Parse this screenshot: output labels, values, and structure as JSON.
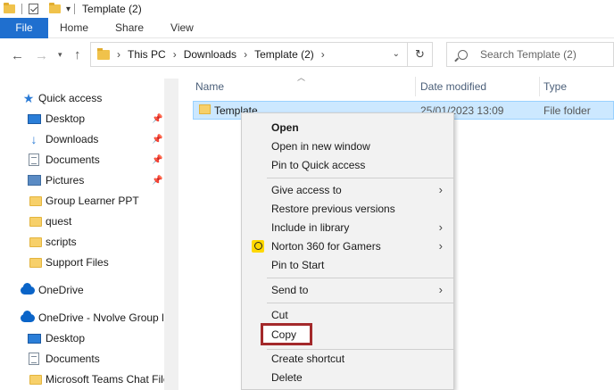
{
  "window": {
    "title": "Template (2)"
  },
  "ribbon": {
    "tabs": [
      "File",
      "Home",
      "Share",
      "View"
    ]
  },
  "address": {
    "crumbs": [
      "This PC",
      "Downloads",
      "Template (2)"
    ],
    "search_placeholder": "Search Template (2)"
  },
  "nav": {
    "items": [
      {
        "label": "Quick access",
        "icon": "star-icon"
      },
      {
        "label": "Desktop",
        "icon": "desktop-icon",
        "pinned": true
      },
      {
        "label": "Downloads",
        "icon": "download-icon",
        "pinned": true
      },
      {
        "label": "Documents",
        "icon": "document-icon",
        "pinned": true
      },
      {
        "label": "Pictures",
        "icon": "pictures-icon",
        "pinned": true
      },
      {
        "label": "Group Learner PPT",
        "icon": "folder-icon"
      },
      {
        "label": "quest",
        "icon": "folder-icon"
      },
      {
        "label": "scripts",
        "icon": "folder-icon"
      },
      {
        "label": "Support Files",
        "icon": "folder-icon"
      },
      {
        "label": "OneDrive",
        "icon": "cloud-icon"
      },
      {
        "label": "OneDrive - Nvolve Group Li",
        "icon": "cloud-icon"
      },
      {
        "label": "Desktop",
        "icon": "desktop-icon"
      },
      {
        "label": "Documents",
        "icon": "document-icon"
      },
      {
        "label": "Microsoft Teams Chat File",
        "icon": "folder-icon"
      }
    ]
  },
  "filelist": {
    "columns": [
      "Name",
      "Date modified",
      "Type"
    ],
    "rows": [
      {
        "name": "Template",
        "date": "25/01/2023 13:09",
        "type": "File folder"
      }
    ]
  },
  "context_menu": {
    "items": [
      {
        "label": "Open",
        "bold": true
      },
      {
        "label": "Open in new window"
      },
      {
        "label": "Pin to Quick access"
      },
      {
        "label": "Give access to",
        "submenu": true
      },
      {
        "label": "Restore previous versions"
      },
      {
        "label": "Include in library",
        "submenu": true
      },
      {
        "label": "Norton 360 for Gamers",
        "submenu": true,
        "icon": "norton-icon"
      },
      {
        "label": "Pin to Start"
      },
      {
        "label": "Send to",
        "submenu": true
      },
      {
        "label": "Cut"
      },
      {
        "label": "Copy",
        "highlighted": true
      },
      {
        "label": "Create shortcut"
      },
      {
        "label": "Delete"
      }
    ]
  },
  "colors": {
    "accent": "#1f6fcf",
    "selection": "#cce8ff",
    "highlight_border": "#a3292b",
    "folder": "#f7d06a"
  }
}
